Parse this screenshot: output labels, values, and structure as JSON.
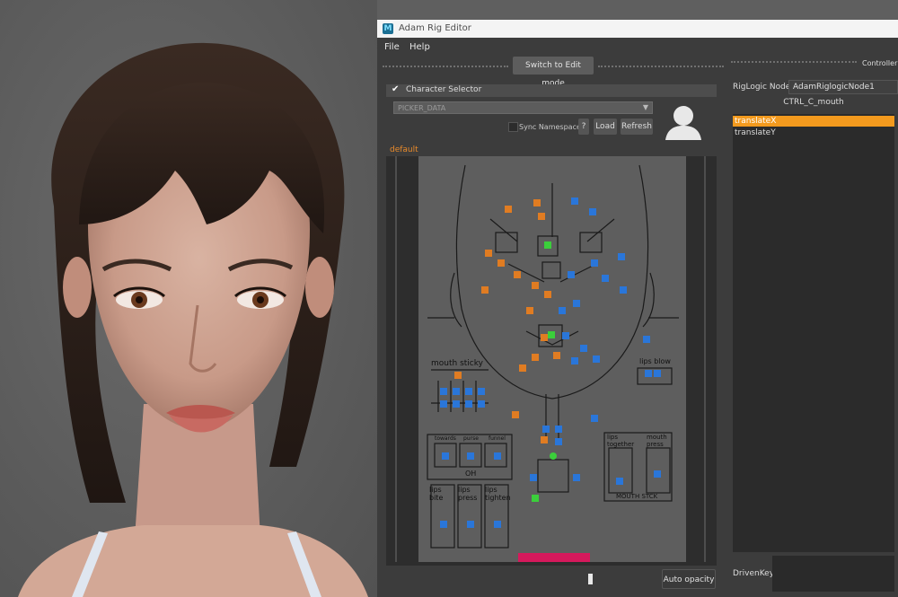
{
  "window": {
    "title": "Adam Rig Editor"
  },
  "menu": {
    "file": "File",
    "help": "Help"
  },
  "toolbar": {
    "edit_mode_button": "Switch to Edit mode"
  },
  "controller_panel": {
    "title": "Controller i"
  },
  "character_selector": {
    "label": "Character Selector",
    "checked": true,
    "combo_value": "PICKER_DATA",
    "sync_namespace_label": "Sync Namespace",
    "help_button": "?",
    "load_button": "Load",
    "refresh_button": "Refresh"
  },
  "picker": {
    "tab_label": "default",
    "labels": {
      "mouth_sticky": "mouth sticky",
      "lips_blow": "lips blow",
      "towards": "towards",
      "purse": "purse",
      "funnel": "funnel",
      "oh": "OH",
      "lips_bite": "lips bite",
      "lips_press": "lips press",
      "lips_tighten": "lips tighten",
      "lips_together": "lips together",
      "mouth_press": "mouth press",
      "mouth_stick": "MOUTH STCK"
    },
    "colors": {
      "orange": "#e07c22",
      "blue": "#2a76d9",
      "green": "#3bcf3b",
      "range_bar": "#d6195c"
    }
  },
  "riglogic": {
    "node_label": "RigLogic Node",
    "node_value": "AdamRiglogicNode1",
    "controller_name": "CTRL_C_mouth",
    "attributes": [
      {
        "label": "translateX",
        "selected": true
      },
      {
        "label": "translateY",
        "selected": false
      }
    ]
  },
  "bottom": {
    "auto_opacity_button": "Auto opacity",
    "driven_key_label": "DrivenKey"
  }
}
